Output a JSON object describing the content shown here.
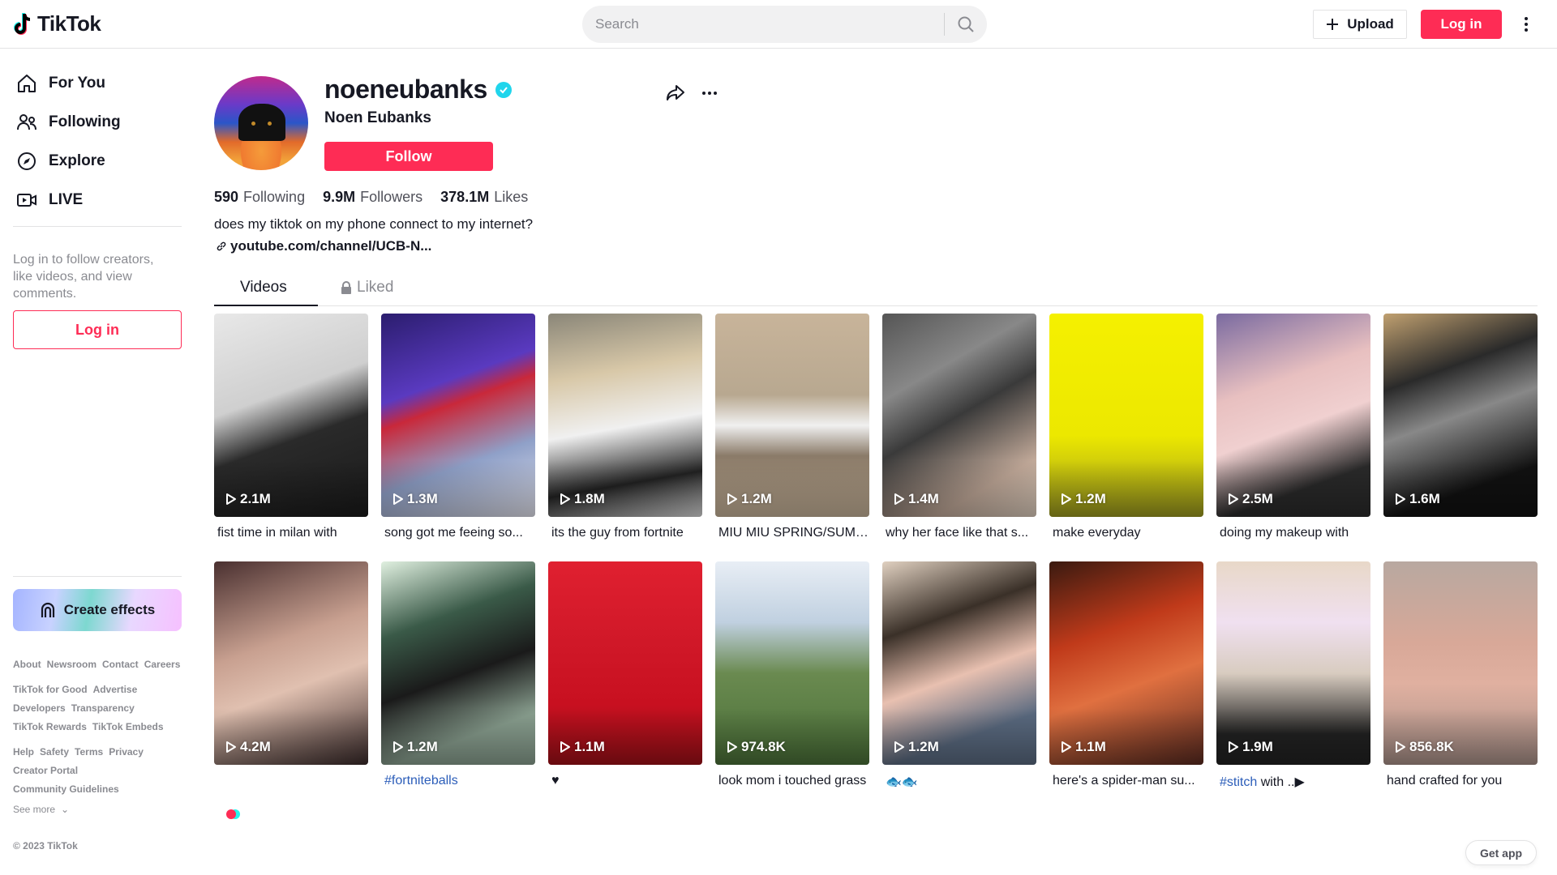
{
  "header": {
    "logo_text": "TikTok",
    "search_placeholder": "Search",
    "upload_label": "Upload",
    "login_label": "Log in"
  },
  "sidebar": {
    "items": [
      {
        "label": "For You",
        "icon": "home-icon"
      },
      {
        "label": "Following",
        "icon": "users-icon"
      },
      {
        "label": "Explore",
        "icon": "compass-icon"
      },
      {
        "label": "LIVE",
        "icon": "live-camera-icon"
      }
    ],
    "login_hint": "Log in to follow creators, like videos, and view comments.",
    "login_label": "Log in",
    "create_effects_label": "Create effects",
    "footer_rows": [
      [
        "About",
        "Newsroom",
        "Contact",
        "Careers"
      ],
      [
        "TikTok for Good",
        "Advertise"
      ],
      [
        "Developers",
        "Transparency"
      ],
      [
        "TikTok Rewards",
        "TikTok Embeds"
      ],
      [
        "Help",
        "Safety",
        "Terms",
        "Privacy"
      ],
      [
        "Creator Portal"
      ],
      [
        "Community Guidelines"
      ]
    ],
    "see_more": "See more",
    "copyright": "© 2023 TikTok"
  },
  "profile": {
    "username": "noeneubanks",
    "verified": true,
    "display_name": "Noen Eubanks",
    "follow_label": "Follow",
    "stats": {
      "following_count": "590",
      "following_label": "Following",
      "followers_count": "9.9M",
      "followers_label": "Followers",
      "likes_count": "378.1M",
      "likes_label": "Likes"
    },
    "bio": "does my tiktok on my phone connect to my internet?",
    "link": "youtube.com/channel/UCB-N..."
  },
  "tabs": [
    {
      "label": "Videos",
      "active": true
    },
    {
      "label": "Liked",
      "locked": true
    }
  ],
  "videos": [
    {
      "views": "2.1M",
      "caption": "fist time in milan with"
    },
    {
      "views": "1.3M",
      "caption": "song got me feeing so..."
    },
    {
      "views": "1.8M",
      "caption": "its the guy from fortnite"
    },
    {
      "views": "1.2M",
      "caption": "MIU MIU SPRING/SUMMER"
    },
    {
      "views": "1.4M",
      "caption": "why her face like that s..."
    },
    {
      "views": "1.2M",
      "caption": "make everyday"
    },
    {
      "views": "2.5M",
      "caption": "doing my makeup with"
    },
    {
      "views": "1.6M",
      "caption": ""
    },
    {
      "views": "4.2M",
      "caption": ""
    },
    {
      "views": "1.2M",
      "caption": "#fortniteballs"
    },
    {
      "views": "1.1M",
      "caption": "♥"
    },
    {
      "views": "974.8K",
      "caption": "look mom i touched grass"
    },
    {
      "views": "1.2M",
      "caption": "🐟🐟"
    },
    {
      "views": "1.1M",
      "caption": "here's a spider-man su..."
    },
    {
      "views": "1.9M",
      "caption_tag": "#stitch",
      "caption": " with ..▶"
    },
    {
      "views": "856.8K",
      "caption": "hand crafted for you"
    }
  ],
  "colors": {
    "brand": "#fe2c55",
    "verified": "#20d5ec",
    "hashtag": "#2b5db9"
  },
  "get_app_label": "Get app"
}
